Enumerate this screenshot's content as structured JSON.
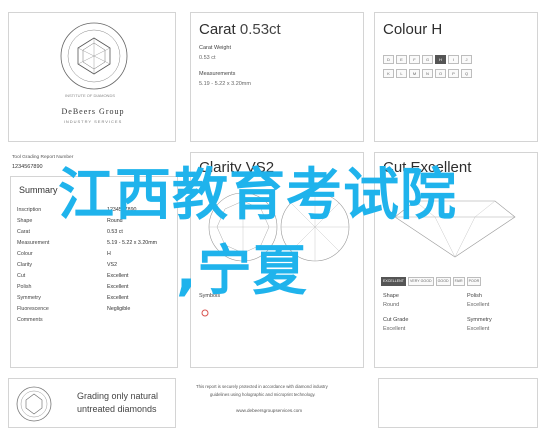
{
  "logo": {
    "seal_text": "INSTITUTE OF DIAMONDS",
    "brand": "DeBeers Group",
    "sub": "INDUSTRY SERVICES"
  },
  "carat_panel": {
    "title_word": "Carat",
    "title_value": "0.53ct",
    "weight_label": "Carat Weight",
    "weight_value": "0.53 ct",
    "measure_label": "Measurements",
    "measure_value": "5.19 - 5.22 x 3.20mm"
  },
  "colour_panel": {
    "title_word": "Colour",
    "title_value": "H",
    "scale": [
      "D",
      "E",
      "F",
      "G",
      "H",
      "I",
      "J",
      "K",
      "L",
      "M",
      "N",
      "O",
      "P",
      "Q"
    ],
    "selected": "H"
  },
  "report": {
    "label": "Tool Grading Report Number",
    "number": "1234567890"
  },
  "summary": {
    "title": "Summary",
    "rows": [
      {
        "label": "Inscription",
        "value": "1234567890"
      },
      {
        "label": "Shape",
        "value": "Round"
      },
      {
        "label": "Carat",
        "value": "0.53 ct"
      },
      {
        "label": "Measurement",
        "value": "5.19 - 5.22 x 3.20mm"
      },
      {
        "label": "Colour",
        "value": "H"
      },
      {
        "label": "Clarity",
        "value": "VS2"
      },
      {
        "label": "Cut",
        "value": "Excellent"
      },
      {
        "label": "Polish",
        "value": "Excellent"
      },
      {
        "label": "Symmetry",
        "value": "Excellent"
      },
      {
        "label": "Fluorescence",
        "value": "Negligible"
      },
      {
        "label": "Comments",
        "value": ""
      }
    ]
  },
  "clarity_panel": {
    "title_word": "Clarity",
    "title_value": "VS2",
    "symbols_label": "Symbols"
  },
  "cut_panel": {
    "title_word": "Cut",
    "title_value": "Excellent",
    "scale": [
      "EXCELLENT",
      "VERY GOOD",
      "GOOD",
      "FAIR",
      "POOR"
    ],
    "selected": "EXCELLENT",
    "shape_label": "Shape",
    "shape_value": "Round",
    "polish_label": "Polish",
    "polish_value": "Excellent",
    "cutgrade_label": "Cut Grade",
    "cutgrade_value": "Excellent",
    "symmetry_label": "Symmetry",
    "symmetry_value": "Excellent"
  },
  "footer": {
    "grading_line1": "Grading only natural",
    "grading_line2": "untreated diamonds",
    "notice1": "This report is securely protected in accordance with diamond industry",
    "notice2": "guidelines using holographic and microprint technology.",
    "notice3": "www.debeersgroupservices.com"
  },
  "overlay": {
    "line1": "江西教育考试院",
    "line2": ",宁夏"
  },
  "colors": {
    "overlay": "#1fb3ec",
    "border": "#d4d4d4",
    "text": "#3a3a3a"
  }
}
